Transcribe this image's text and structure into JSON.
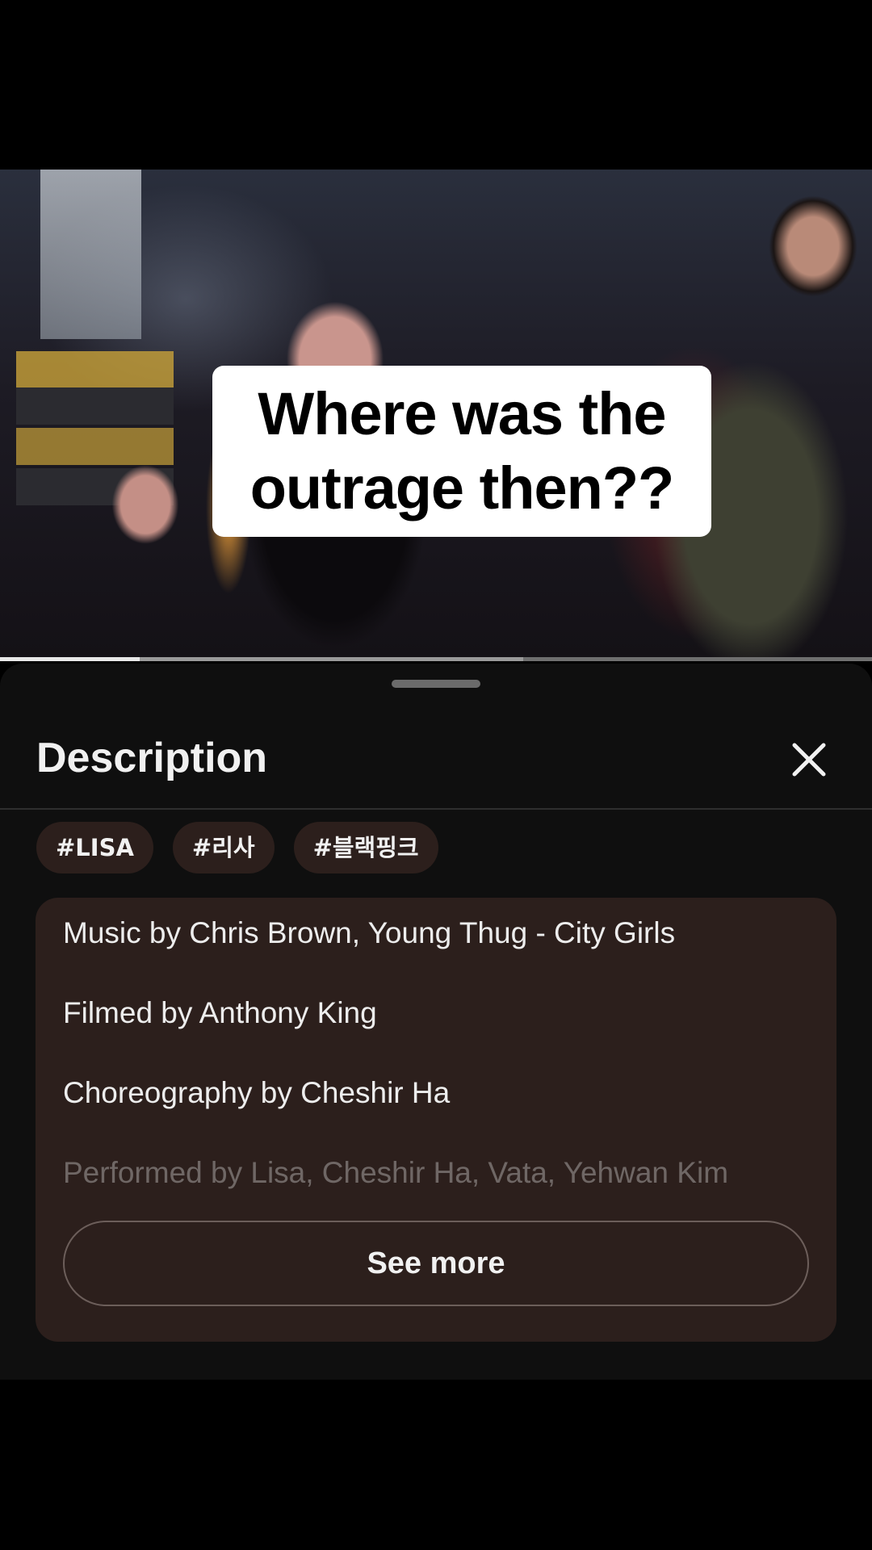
{
  "video": {
    "caption_lines": [
      "Where was the",
      "outrage then??"
    ],
    "progress": 0.16,
    "buffered": 0.6
  },
  "sheet": {
    "title": "Description",
    "close_icon": "close-icon",
    "hashtags": [
      "#LISA",
      "#리사",
      "#블랙핑크"
    ],
    "description_lines": [
      "Music by Chris Brown, Young Thug - City Girls",
      "Filmed by Anthony King",
      "Choreography by Cheshir Ha",
      "Performed by Lisa, Cheshir Ha, Vata, Yehwan Kim"
    ],
    "see_more_label": "See more"
  },
  "colors": {
    "sheet_bg": "#0f0f0f",
    "card_bg": "#2c1f1c",
    "text": "#f1f1f1"
  }
}
